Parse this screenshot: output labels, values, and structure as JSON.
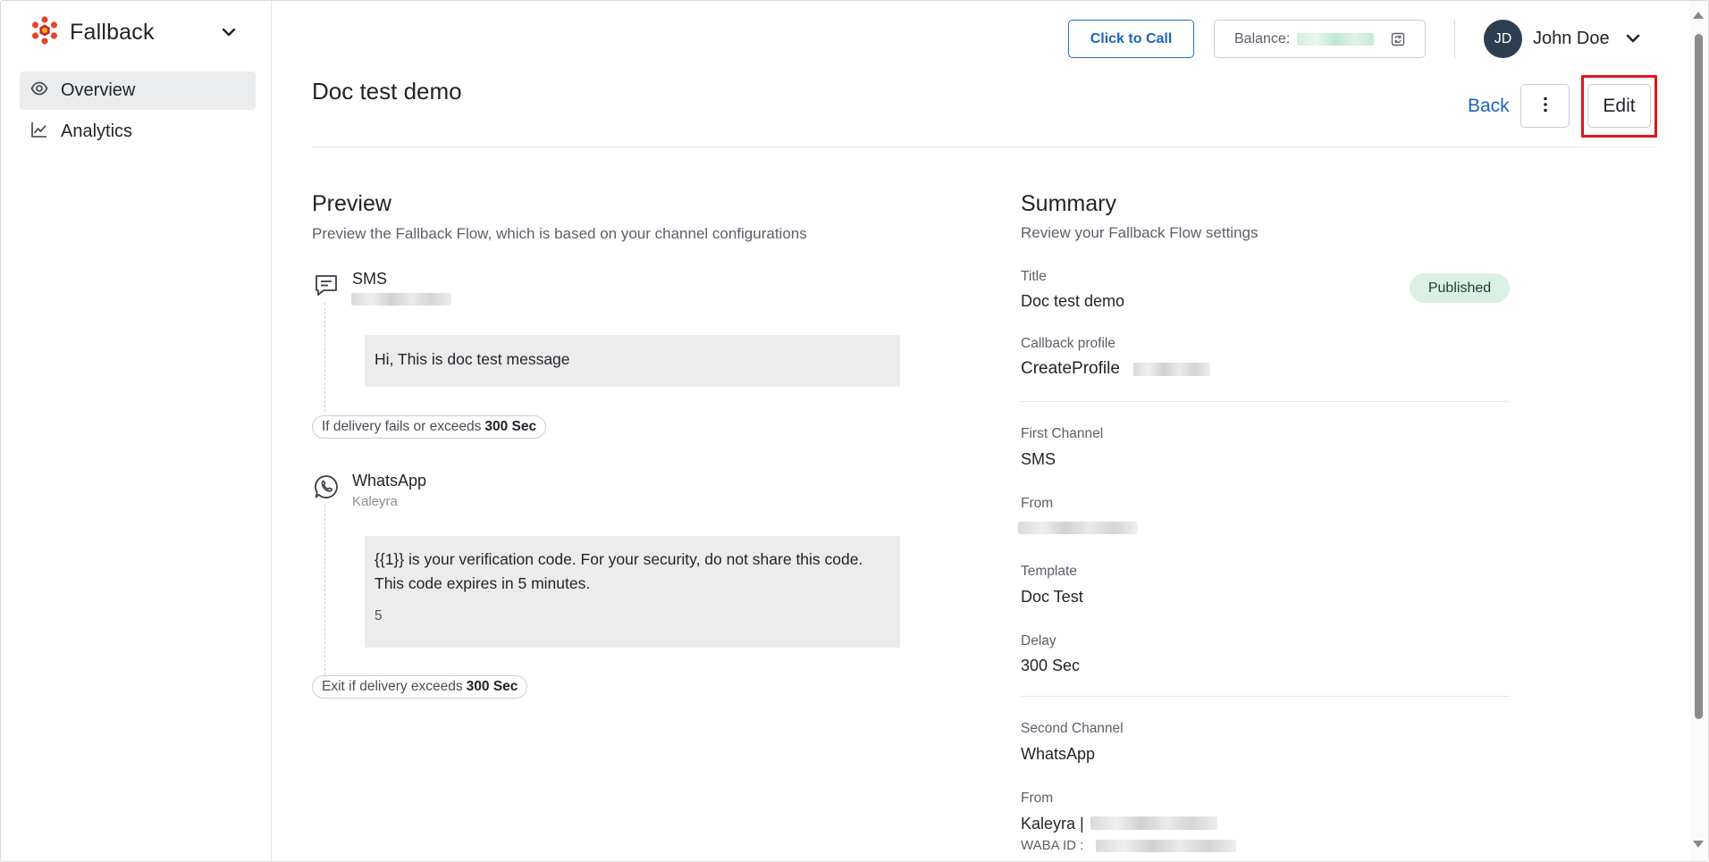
{
  "app": {
    "brand_name": "Fallback"
  },
  "sidebar": {
    "items": [
      {
        "label": "Overview",
        "icon": "eye-icon",
        "active": true
      },
      {
        "label": "Analytics",
        "icon": "chart-line-icon",
        "active": false
      }
    ]
  },
  "header": {
    "click_to_call": "Click to Call",
    "balance_label": "Balance:",
    "user_initials": "JD",
    "user_name": "John Doe"
  },
  "page": {
    "title": "Doc test demo",
    "back_label": "Back",
    "edit_label": "Edit"
  },
  "preview": {
    "title": "Preview",
    "subtitle": "Preview the Fallback Flow, which is based on your channel configurations",
    "first": {
      "name": "SMS",
      "message": "Hi, This is doc test message",
      "condition_text": "If delivery fails or exceeds",
      "condition_value": "300 Sec"
    },
    "second": {
      "name": "WhatsApp",
      "sender": "Kaleyra",
      "message_line1": "{{1}} is your verification code. For your security, do not share this code.",
      "message_line2": "This code expires in 5 minutes.",
      "message_footer": "5",
      "exit_text": "Exit if delivery exceeds",
      "exit_value": "300 Sec"
    }
  },
  "summary": {
    "title": "Summary",
    "subtitle": "Review your Fallback Flow settings",
    "title_label": "Title",
    "title_value": "Doc test demo",
    "status": "Published",
    "callback_label": "Callback profile",
    "callback_value": "CreateProfile",
    "first_channel_label": "First Channel",
    "first_channel_value": "SMS",
    "from_label": "From",
    "template_label": "Template",
    "template_value": "Doc Test",
    "delay_label": "Delay",
    "delay_value": "300 Sec",
    "second_channel_label": "Second Channel",
    "second_channel_value": "WhatsApp",
    "from2_label": "From",
    "from2_value": "Kaleyra |",
    "waba_label": "WABA ID :"
  },
  "colors": {
    "primary": "#1b63c4",
    "highlight": "#e3141b",
    "badge_bg": "#d9f0e3",
    "avatar_bg": "#2c3e50"
  }
}
